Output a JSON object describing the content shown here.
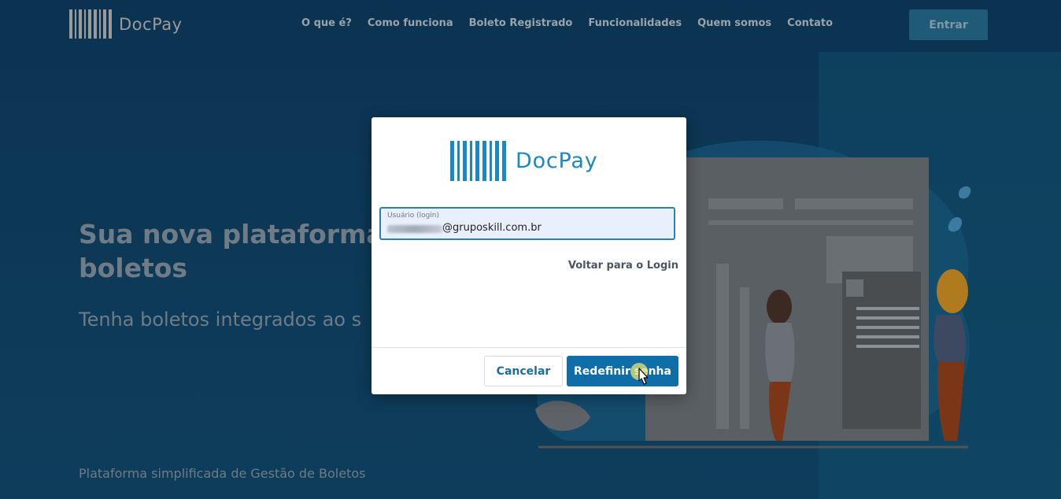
{
  "header": {
    "logo_text": "DocPay",
    "nav": [
      "O que é?",
      "Como funciona",
      "Boleto Registrado",
      "Funcionalidades",
      "Quem somos",
      "Contato"
    ],
    "login_button": "Entrar"
  },
  "hero": {
    "title_line1": "Sua nova plataforma",
    "title_line2": "boletos",
    "subtitle": "Tenha boletos integrados ao s",
    "footer_text": "Plataforma simplificada de Gestão de Boletos"
  },
  "modal": {
    "logo_text": "DocPay",
    "username_label": "Usuário (login)",
    "username_value": "@gruposkill.com.br",
    "back_link": "Voltar para o Login",
    "cancel_button": "Cancelar",
    "submit_button": "Redefinir senha"
  },
  "colors": {
    "brand_blue": "#1b88c6",
    "primary_button": "#0f6da8",
    "background": "#0a3350"
  },
  "icons": [
    "barcode-logo-icon",
    "pointer-cursor-icon"
  ]
}
